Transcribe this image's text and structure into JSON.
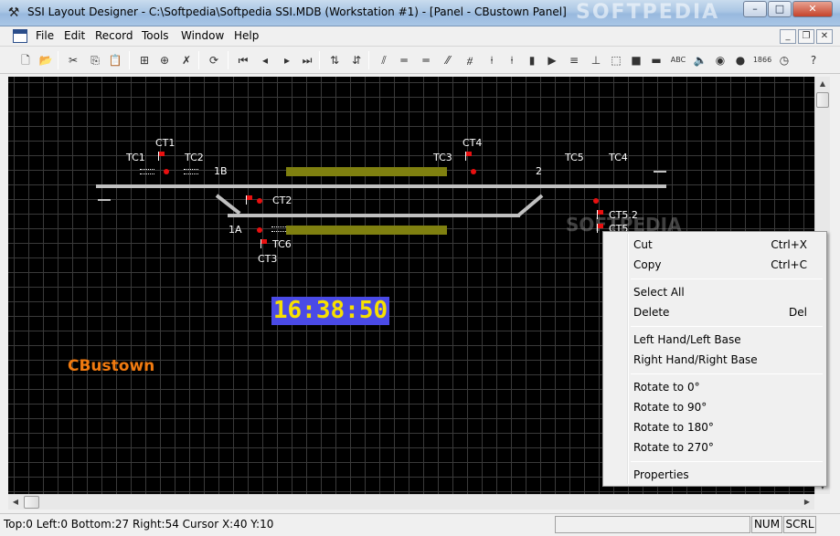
{
  "window": {
    "title": "SSI Layout Designer - C:\\Softpedia\\Softpedia SSI.MDB (Workstation #1) - [Panel - CBustown Panel]",
    "watermark": "SOFTPEDIA",
    "minimize": "–",
    "maximize": "□",
    "close": "✕"
  },
  "menubar": {
    "items": [
      "File",
      "Edit",
      "Record",
      "Tools",
      "Window",
      "Help"
    ],
    "mdi_minimize": "_",
    "mdi_restore": "❐",
    "mdi_close": "✕"
  },
  "toolbar": {
    "buttons": [
      {
        "icon": "new-icon",
        "glyph": "🗋"
      },
      {
        "icon": "open-icon",
        "glyph": "📂"
      },
      {
        "icon": "cut-icon",
        "glyph": "✂"
      },
      {
        "icon": "copy-icon",
        "glyph": "⎘"
      },
      {
        "icon": "paste-icon",
        "glyph": "📋"
      },
      {
        "icon": "add-record-icon",
        "glyph": "⊞"
      },
      {
        "icon": "insert-record-icon",
        "glyph": "⊕"
      },
      {
        "icon": "delete-record-icon",
        "glyph": "✗"
      },
      {
        "icon": "refresh-icon",
        "glyph": "⟳"
      },
      {
        "icon": "first-record-icon",
        "glyph": "⏮"
      },
      {
        "icon": "prev-record-icon",
        "glyph": "◂"
      },
      {
        "icon": "next-record-icon",
        "glyph": "▸"
      },
      {
        "icon": "last-record-icon",
        "glyph": "⏭"
      },
      {
        "icon": "sort-ascending-icon",
        "glyph": "⇅"
      },
      {
        "icon": "sort-descending-icon",
        "glyph": "⇵"
      },
      {
        "icon": "points-track-icon",
        "glyph": "⫽"
      },
      {
        "icon": "double-track-icon",
        "glyph": "═"
      },
      {
        "icon": "track-icon",
        "glyph": "═"
      },
      {
        "icon": "diagonal-track-icon",
        "glyph": "⁄⁄"
      },
      {
        "icon": "crossover-icon",
        "glyph": "⧣"
      },
      {
        "icon": "signal-red-icon",
        "glyph": "⍿"
      },
      {
        "icon": "signal-icon",
        "glyph": "⍿"
      },
      {
        "icon": "shunt-signal-icon",
        "glyph": "▮"
      },
      {
        "icon": "arrow-icon",
        "glyph": "▶"
      },
      {
        "icon": "track-circuit-icon",
        "glyph": "≡"
      },
      {
        "icon": "buffer-icon",
        "glyph": "⊥"
      },
      {
        "icon": "selection-icon",
        "glyph": "⬚"
      },
      {
        "icon": "grey-block-icon",
        "glyph": "■"
      },
      {
        "icon": "platform-icon",
        "glyph": "▬"
      },
      {
        "icon": "text-icon",
        "glyph": "ABC"
      },
      {
        "icon": "speaker-icon",
        "glyph": "🔈"
      },
      {
        "icon": "indicator-icon",
        "glyph": "◉"
      },
      {
        "icon": "lamp-icon",
        "glyph": "●"
      },
      {
        "icon": "counter-icon",
        "glyph": "1866"
      },
      {
        "icon": "clock-icon",
        "glyph": "◷"
      },
      {
        "icon": "help-icon",
        "glyph": "?"
      }
    ]
  },
  "panel": {
    "labels": {
      "tc1": "TC1",
      "ct1": "CT1",
      "tc2": "TC2",
      "b1": "1B",
      "tc3": "TC3",
      "ct4": "CT4",
      "p2": "2",
      "tc5": "TC5",
      "tc4": "TC4",
      "ct2": "CT2",
      "a1": "1A",
      "tc6": "TC6",
      "ct3": "CT3",
      "ct52": "CT5.2",
      "ct5": "CT5"
    },
    "clock": "16:38:50",
    "name": "CBustown",
    "watermark": "SOFTPEDIA"
  },
  "context_menu": {
    "items": [
      {
        "label": "Cut",
        "shortcut": "Ctrl+X"
      },
      {
        "label": "Copy",
        "shortcut": "Ctrl+C"
      },
      {
        "label": "Select All",
        "shortcut": ""
      },
      {
        "label": "Delete",
        "shortcut": "Del"
      },
      {
        "label": "Left Hand/Left Base",
        "shortcut": ""
      },
      {
        "label": "Right Hand/Right Base",
        "shortcut": ""
      },
      {
        "label": "Rotate to 0°",
        "shortcut": ""
      },
      {
        "label": "Rotate to 90°",
        "shortcut": ""
      },
      {
        "label": "Rotate to 180°",
        "shortcut": ""
      },
      {
        "label": "Rotate to 270°",
        "shortcut": ""
      },
      {
        "label": "Properties",
        "shortcut": ""
      }
    ]
  },
  "scroll": {
    "up": "▲",
    "down": "▼",
    "left": "◀",
    "right": "▶"
  },
  "statusbar": {
    "text": "Top:0  Left:0  Bottom:27  Right:54   Cursor X:40 Y:10",
    "num": "NUM",
    "scrl": "SCRL"
  }
}
